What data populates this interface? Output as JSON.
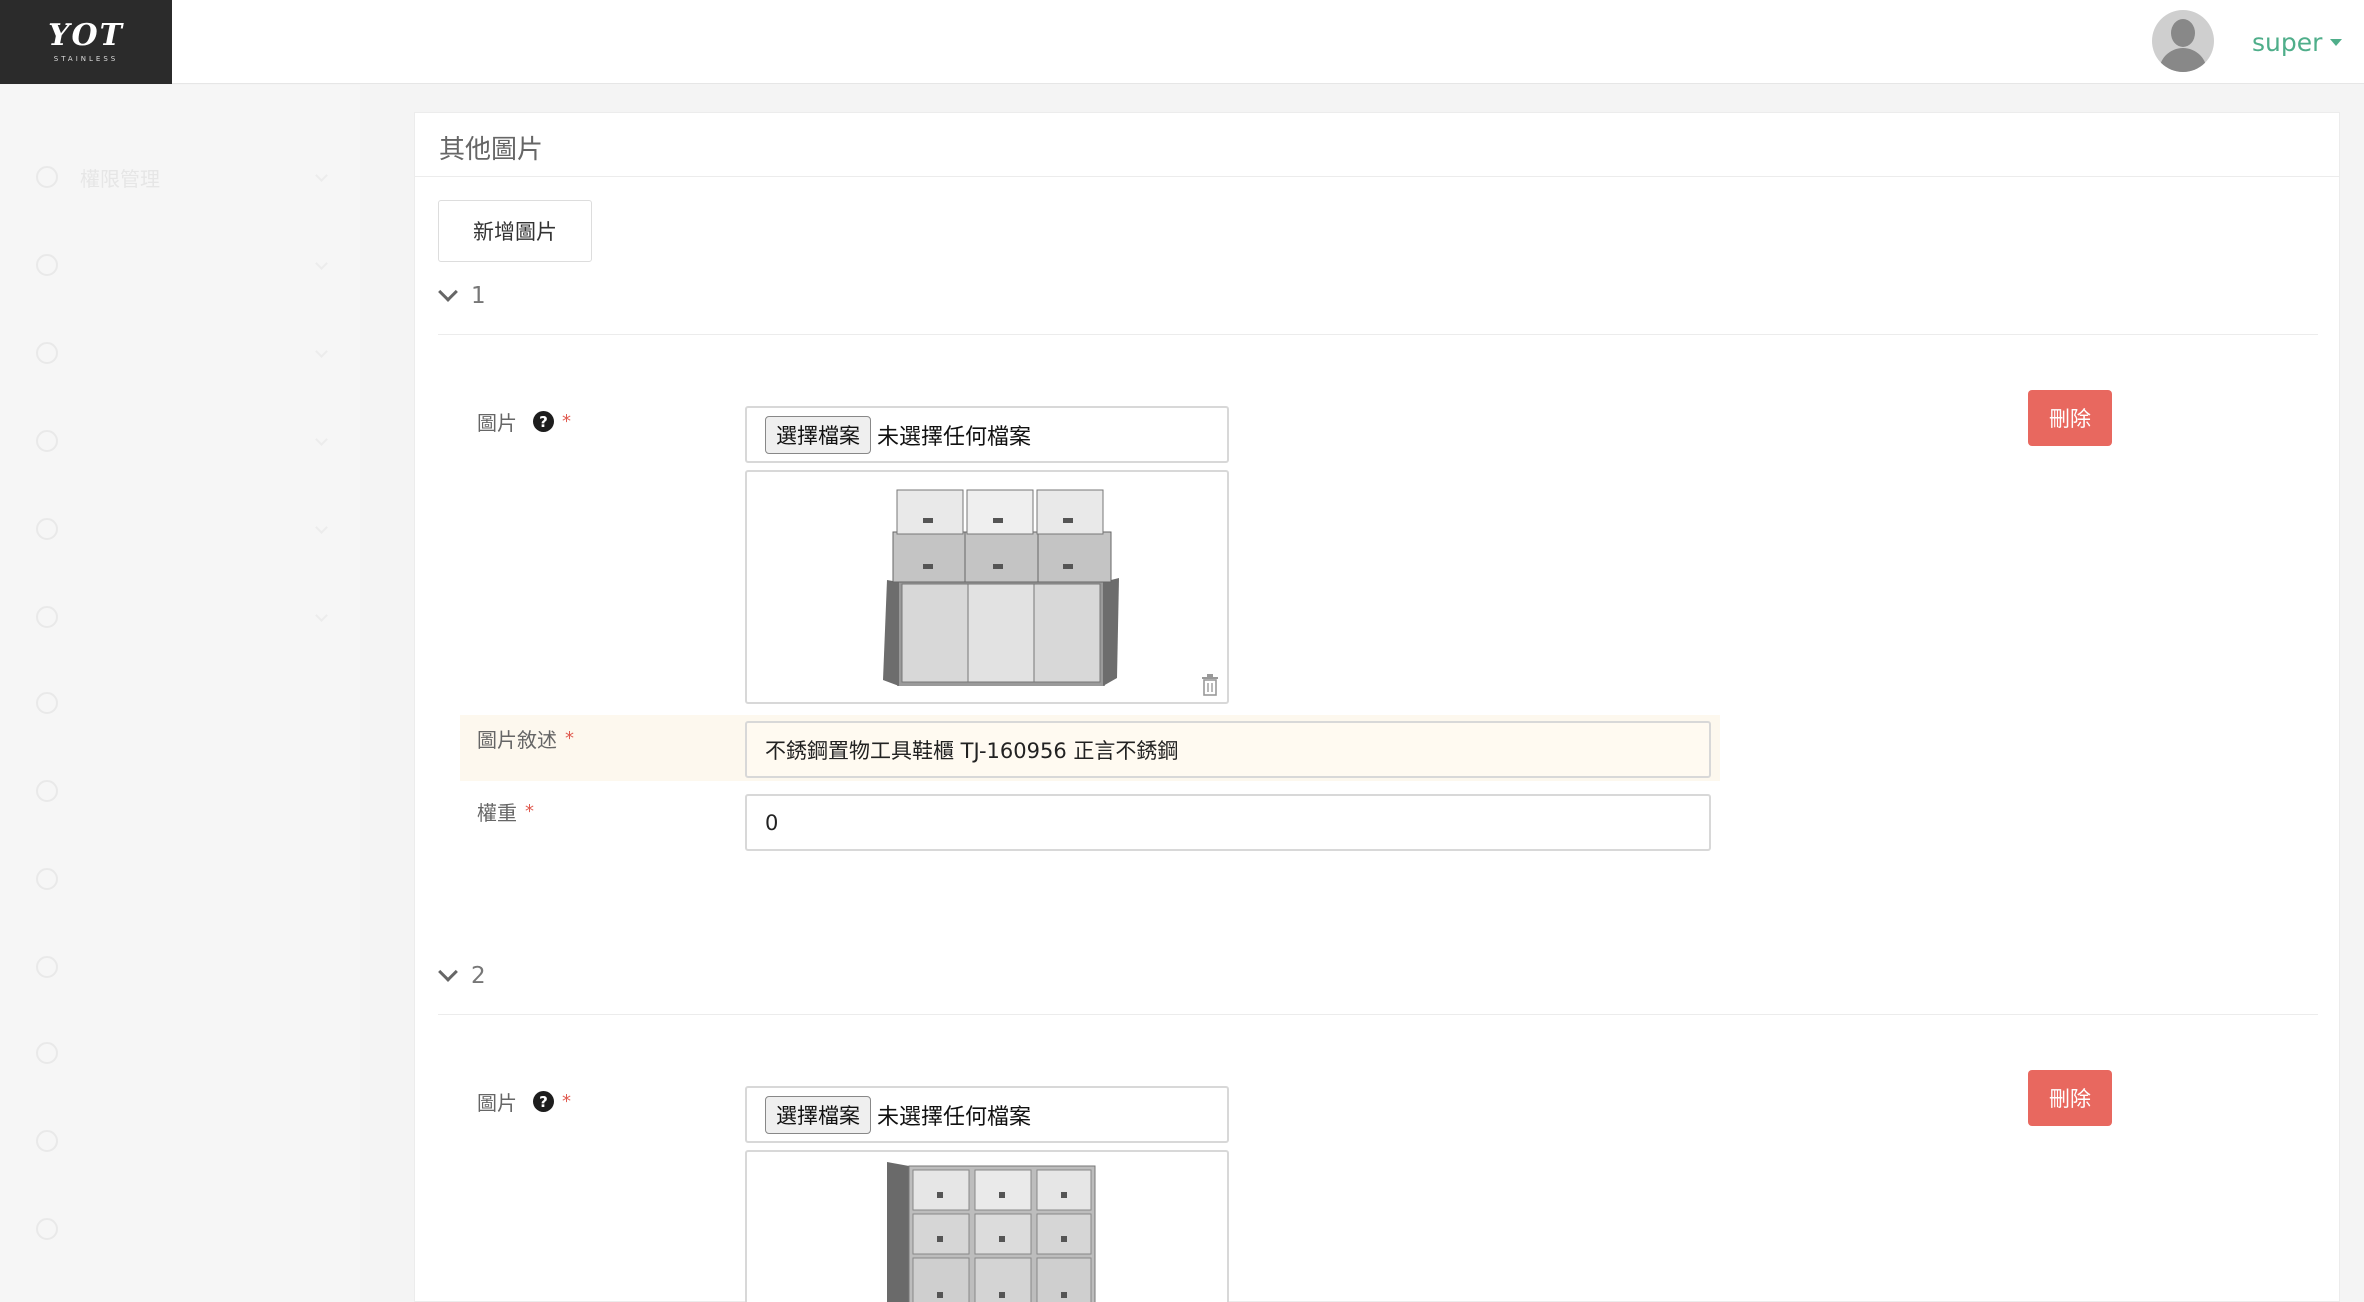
{
  "header": {
    "logo_text": "YOT",
    "logo_subtext": "STAINLESS",
    "user_name": "super"
  },
  "sidebar": {
    "items": [
      {
        "label": "權限管理",
        "has_chevron": true
      },
      {
        "label": "",
        "has_chevron": true
      },
      {
        "label": "",
        "has_chevron": true
      },
      {
        "label": "",
        "has_chevron": true
      },
      {
        "label": "",
        "has_chevron": true
      },
      {
        "label": "",
        "has_chevron": true
      },
      {
        "label": "",
        "has_chevron": false
      },
      {
        "label": "",
        "has_chevron": false
      },
      {
        "label": "",
        "has_chevron": false
      },
      {
        "label": "",
        "has_chevron": false
      },
      {
        "label": "",
        "has_chevron": false
      },
      {
        "label": "",
        "has_chevron": false
      },
      {
        "label": "",
        "has_chevron": false
      }
    ]
  },
  "panel": {
    "title": "其他圖片",
    "add_button": "新增圖片",
    "field_labels": {
      "image": "圖片",
      "description": "圖片敘述",
      "weight": "權重",
      "required_mark": "*"
    },
    "file_input": {
      "button": "選擇檔案",
      "status": "未選擇任何檔案"
    },
    "delete_button": "刪除",
    "entries": [
      {
        "index": "1",
        "description": "不銹鋼置物工具鞋櫃 TJ-160956 正言不銹鋼",
        "weight": "0"
      },
      {
        "index": "2"
      }
    ]
  },
  "colors": {
    "brand_green": "#4fae8a",
    "delete_red": "#e8685f",
    "logo_bg": "#2b2b2b"
  }
}
